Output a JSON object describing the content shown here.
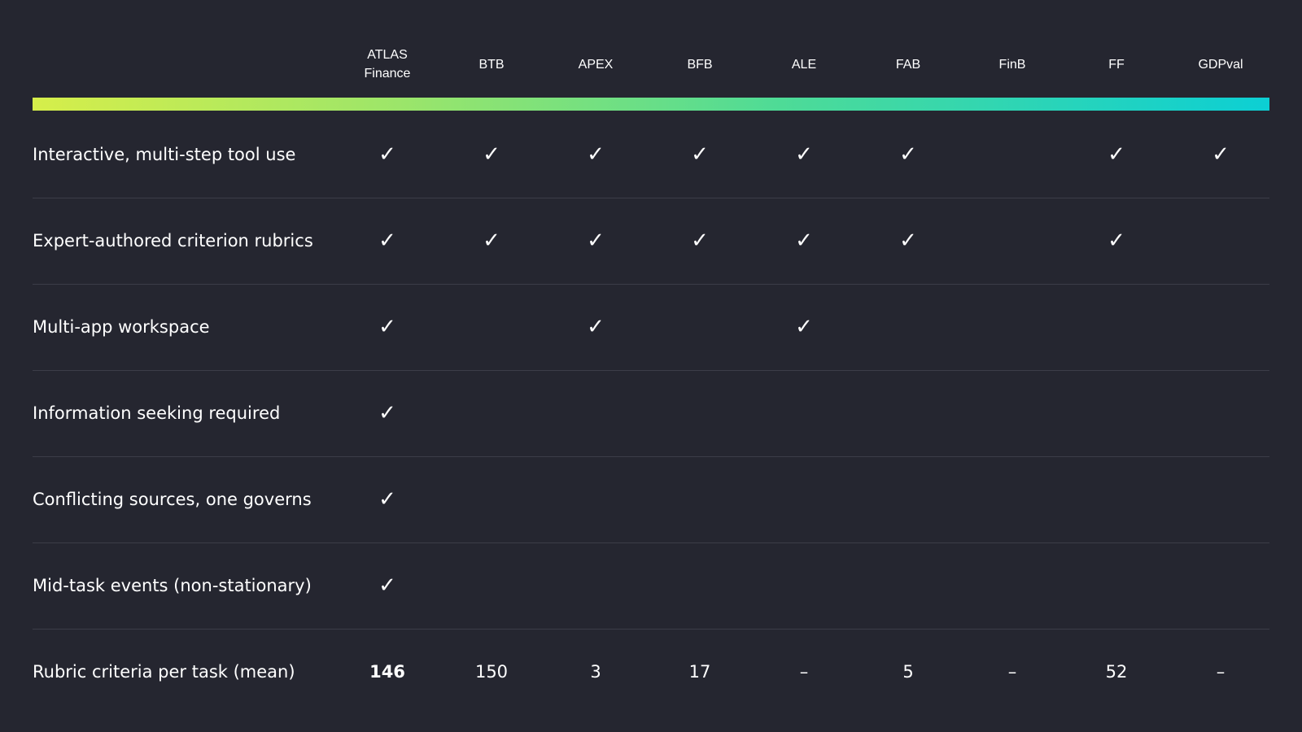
{
  "columns": [
    "ATLAS\nFinance",
    "BTB",
    "APEX",
    "BFB",
    "ALE",
    "FAB",
    "FinB",
    "FF",
    "GDPval"
  ],
  "check_symbol": "✓",
  "rows": [
    {
      "label": "Interactive, multi-step tool use",
      "cells": [
        "✓",
        "✓",
        "✓",
        "✓",
        "✓",
        "✓",
        "",
        "✓",
        "✓"
      ]
    },
    {
      "label": "Expert-authored criterion rubrics",
      "cells": [
        "✓",
        "✓",
        "✓",
        "✓",
        "✓",
        "✓",
        "",
        "✓",
        ""
      ]
    },
    {
      "label": "Multi-app workspace",
      "cells": [
        "✓",
        "",
        "✓",
        "",
        "✓",
        "",
        "",
        "",
        ""
      ]
    },
    {
      "label": "Information seeking required",
      "cells": [
        "✓",
        "",
        "",
        "",
        "",
        "",
        "",
        "",
        ""
      ]
    },
    {
      "label": "Conflicting sources, one governs",
      "cells": [
        "✓",
        "",
        "",
        "",
        "",
        "",
        "",
        "",
        ""
      ]
    },
    {
      "label": "Mid-task events (non-stationary)",
      "cells": [
        "✓",
        "",
        "",
        "",
        "",
        "",
        "",
        "",
        ""
      ]
    },
    {
      "label": "Rubric criteria per task (mean)",
      "cells": [
        "146",
        "150",
        "3",
        "17",
        "–",
        "5",
        "–",
        "52",
        "–"
      ]
    }
  ],
  "gradient_colors": [
    "#d6ee4a",
    "#9be56a",
    "#4fdb96",
    "#0ccfd4"
  ],
  "background_color": "#252630"
}
